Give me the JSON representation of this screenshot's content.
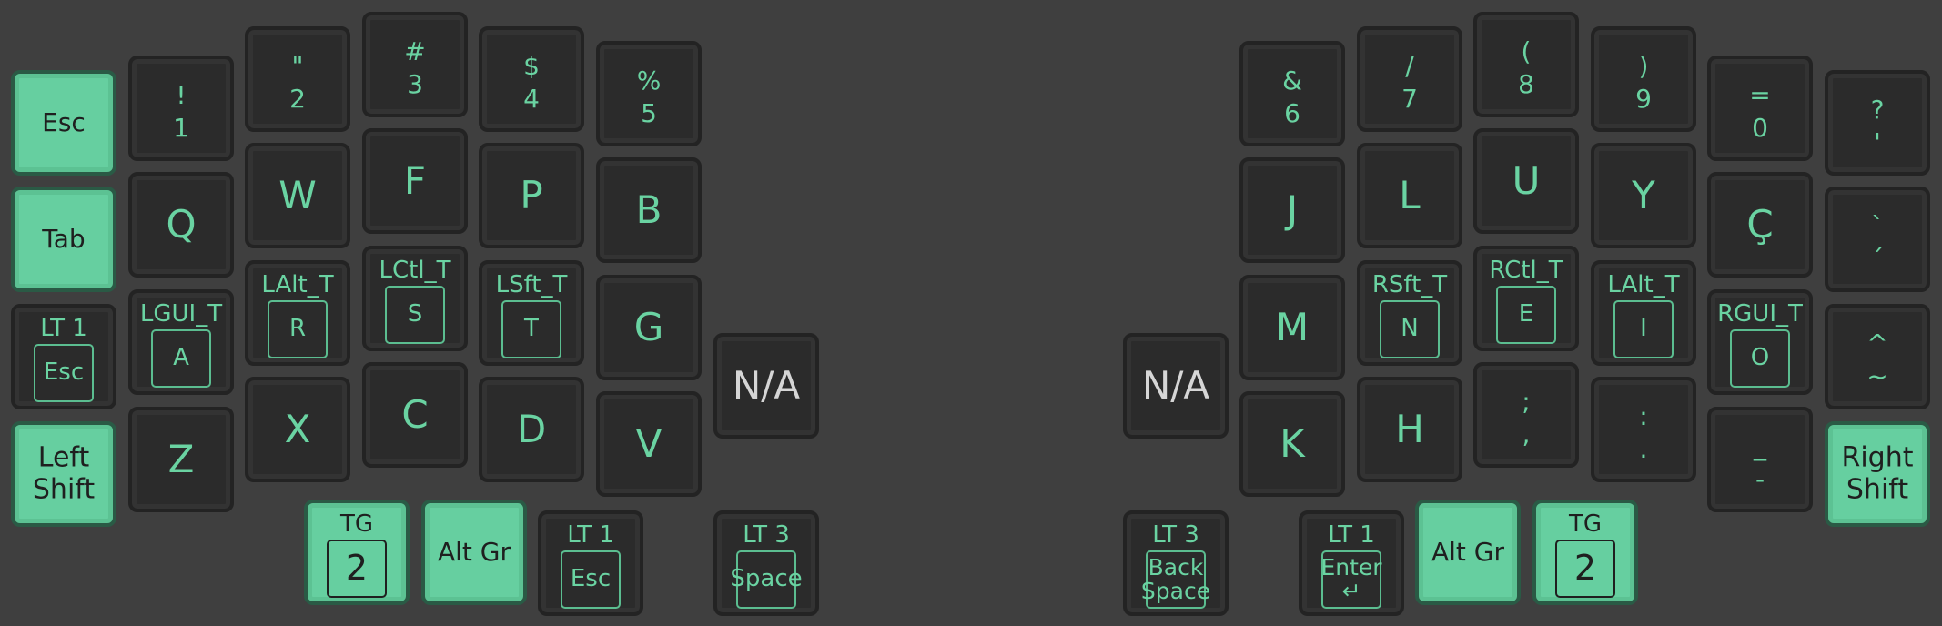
{
  "colors": {
    "background": "#3f3f3f",
    "key_dark": "#2b2b2b",
    "key_accent": "#66cfa0",
    "legend_accent": "#6ad3a2",
    "legend_dark": "#1f1f1f",
    "legend_gray": "#d6d6d6"
  },
  "keys": {
    "esc": "Esc",
    "tab": "Tab",
    "lt1_esc": {
      "label": "LT 1",
      "tap": "Esc"
    },
    "left_shift": "Left\nShift",
    "n1": {
      "shift": "!",
      "base": "1"
    },
    "n2": {
      "shift": "\"",
      "base": "2"
    },
    "n3": {
      "shift": "#",
      "base": "3"
    },
    "n4": {
      "shift": "$",
      "base": "4"
    },
    "n5": {
      "shift": "%",
      "base": "5"
    },
    "q": "Q",
    "w": "W",
    "f": "F",
    "p": "P",
    "b": "B",
    "a": {
      "label": "LGUI_T",
      "tap": "A"
    },
    "r": {
      "label": "LAlt_T",
      "tap": "R"
    },
    "s": {
      "label": "LCtl_T",
      "tap": "S"
    },
    "t": {
      "label": "LSft_T",
      "tap": "T"
    },
    "g": "G",
    "z": "Z",
    "x": "X",
    "c": "C",
    "d": "D",
    "v": "V",
    "na_left": "N/A",
    "tg2_left": {
      "label": "TG",
      "tap": "2"
    },
    "altgr_left": "Alt Gr",
    "lt1_esc_thumb": {
      "label": "LT 1",
      "tap": "Esc"
    },
    "lt3_space": {
      "label": "LT 3",
      "tap": "Space"
    },
    "n6": {
      "shift": "&",
      "base": "6"
    },
    "n7": {
      "shift": "/",
      "base": "7"
    },
    "n8": {
      "shift": "(",
      "base": "8"
    },
    "n9": {
      "shift": ")",
      "base": "9"
    },
    "n0": {
      "shift": "=",
      "base": "0"
    },
    "quest": {
      "shift": "?",
      "base": "'"
    },
    "j": "J",
    "l": "L",
    "u": "U",
    "y": "Y",
    "cced": "Ç",
    "grave": {
      "shift": "`",
      "base": "´"
    },
    "m": "M",
    "n": {
      "label": "RSft_T",
      "tap": "N"
    },
    "e": {
      "label": "RCtl_T",
      "tap": "E"
    },
    "i": {
      "label": "LAlt_T",
      "tap": "I"
    },
    "o": {
      "label": "RGUI_T",
      "tap": "O"
    },
    "caret": {
      "shift": "^",
      "base": "~"
    },
    "na_right": "N/A",
    "k": "K",
    "h": "H",
    "semi": {
      "shift": ";",
      "base": ","
    },
    "colon": {
      "shift": ":",
      "base": "."
    },
    "under": {
      "shift": "_",
      "base": "-"
    },
    "right_shift": "Right\nShift",
    "lt3_bksp": {
      "label": "LT 3",
      "tap": "Back\nSpace"
    },
    "lt1_enter": {
      "label": "LT 1",
      "tap": "Enter\n↵"
    },
    "altgr_right": "Alt Gr",
    "tg2_right": {
      "label": "TG",
      "tap": "2"
    }
  }
}
